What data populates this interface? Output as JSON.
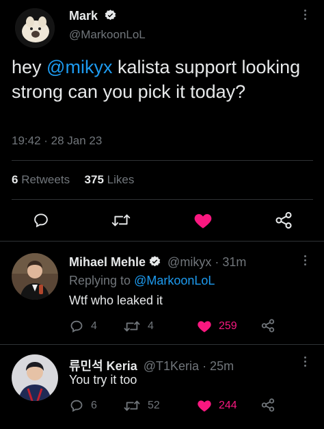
{
  "main_tweet": {
    "author_name": "Mark",
    "author_handle": "@MarkoonLoL",
    "text_prefix": "hey ",
    "mention": "@mikyx",
    "text_suffix": " kalista support looking strong can you pick it today?",
    "time": "19:42 · 28 Jan 23",
    "retweets_count": "6",
    "retweets_label": "Retweets",
    "likes_count": "375",
    "likes_label": "Likes",
    "liked": true
  },
  "replies": [
    {
      "author_name": "Mihael Mehle",
      "verified": true,
      "author_handle": "@mikyx",
      "time": "· 31m",
      "replying_label": "Replying to",
      "replying_to": "@MarkoonLoL",
      "text": "Wtf who leaked it",
      "reply_count": "4",
      "retweet_count": "4",
      "like_count": "259",
      "liked": true
    },
    {
      "author_name": "류민석 Keria",
      "verified": false,
      "author_handle": "@T1Keria",
      "time": "· 25m",
      "text": "You try it too",
      "reply_count": "6",
      "retweet_count": "52",
      "like_count": "244",
      "liked": true
    }
  ],
  "colors": {
    "background": "#000000",
    "text": "#e7e9ea",
    "muted": "#71767b",
    "link": "#1d9bf0",
    "like": "#f91880",
    "divider": "#2f3336"
  },
  "icons": [
    "verified-badge-icon",
    "more-options-icon",
    "reply-icon",
    "retweet-icon",
    "like-heart-icon",
    "share-icon"
  ]
}
